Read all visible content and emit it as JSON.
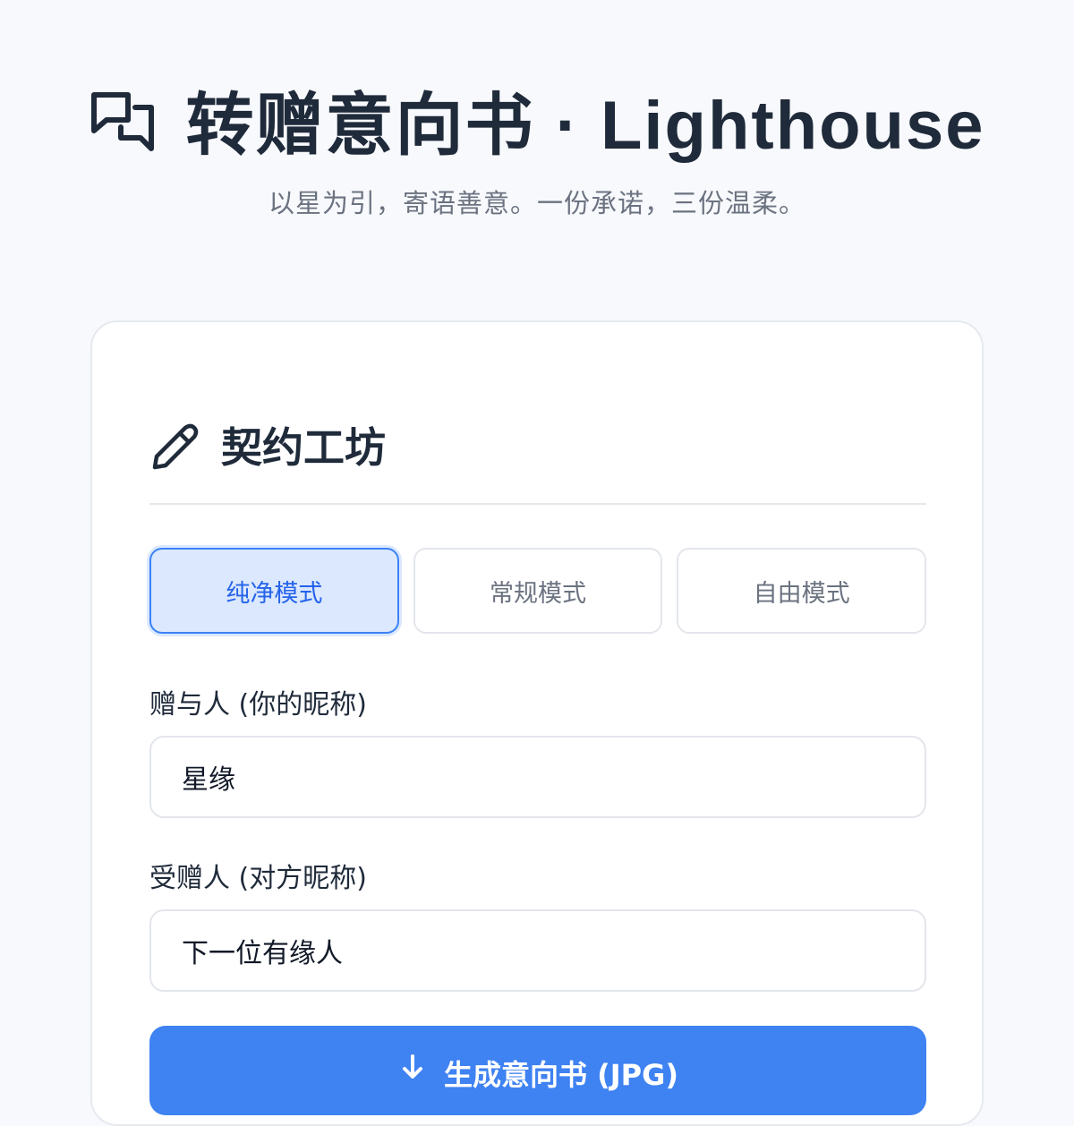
{
  "header": {
    "logo_icon": "chat-bubbles-icon",
    "title": "转赠意向书 · Lighthouse",
    "subtitle": "以星为引，寄语善意。一份承诺，三份温柔。"
  },
  "card": {
    "section_icon": "pencil-icon",
    "section_title": "契约工坊",
    "modes": [
      {
        "label": "纯净模式",
        "active": true
      },
      {
        "label": "常规模式",
        "active": false
      },
      {
        "label": "自由模式",
        "active": false
      }
    ],
    "giver": {
      "label": "赠与人 (你的昵称)",
      "value": "星缘"
    },
    "receiver": {
      "label": "受赠人 (对方昵称)",
      "value": "下一位有缘人"
    },
    "submit": {
      "icon": "download-icon",
      "label": "生成意向书 (JPG)"
    }
  },
  "colors": {
    "accent": "#3f82f2",
    "active_bg": "#dbe8fd",
    "text_dark": "#1f2a3a",
    "text_muted": "#6b7280"
  }
}
